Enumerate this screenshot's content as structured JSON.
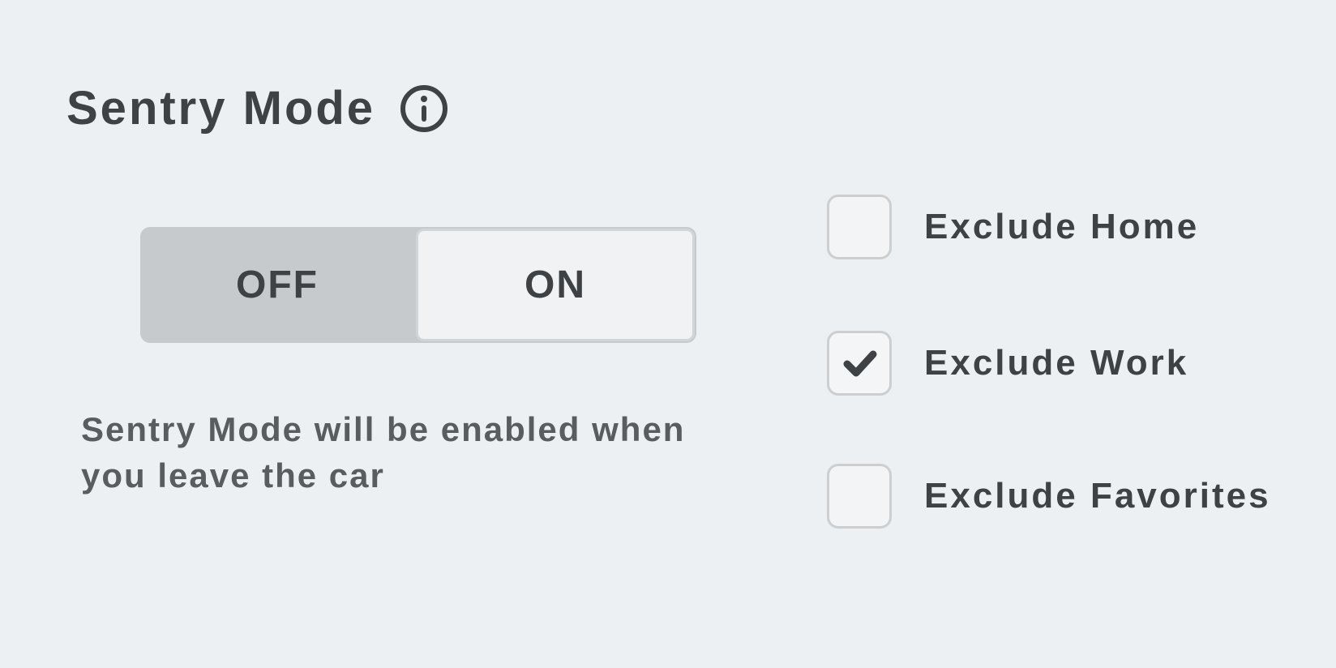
{
  "title": "Sentry Mode",
  "toggle": {
    "off_label": "OFF",
    "on_label": "ON",
    "value": "on"
  },
  "description": "Sentry Mode will be enabled when you leave the car",
  "exclusions": {
    "home": {
      "label": "Exclude Home",
      "checked": false
    },
    "work": {
      "label": "Exclude Work",
      "checked": true
    },
    "favorites": {
      "label": "Exclude Favorites",
      "checked": false
    }
  }
}
